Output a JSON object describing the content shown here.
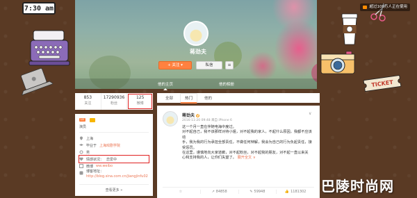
{
  "decor": {
    "clock": "7:30 am",
    "ticket": "TICKET",
    "watermark": "巴陵时尚网"
  },
  "cover": {
    "notice": "超过100万人正在使用",
    "username": "蒋劲夫",
    "subtitle": "",
    "follow_label": "+ 关注 ▾",
    "message_label": "私信",
    "more_label": "≡",
    "tabs": [
      {
        "label": "他的主页",
        "active": true
      },
      {
        "label": "他的相册",
        "active": false
      }
    ]
  },
  "stats": [
    {
      "num": "853",
      "label": "关注"
    },
    {
      "num": "17290936",
      "label": "粉丝"
    },
    {
      "num": "125",
      "label": "微博",
      "highlight": true
    }
  ],
  "info": {
    "level_label": "LV",
    "level_text": "",
    "tag": "演员",
    "location": "上海",
    "school_prefix": "毕业于",
    "school": "上海戏剧学院",
    "gender_label": "男",
    "feeling_prefix": "情感状况：",
    "feeling": "恋爱中",
    "weibo_prefix": "微博",
    "weibo": "ww.weibo",
    "blog_prefix": "博客地址：",
    "blog": "http://blog.sina.com.cn/jiangjinfu02",
    "more_label": "查看更多 »"
  },
  "feed_tabs": [
    {
      "label": "全部",
      "active": false
    },
    {
      "label": "热门",
      "active": true
    },
    {
      "label": "他的",
      "active": false
    }
  ],
  "post": {
    "author": "蒋劲夫",
    "verified": "V",
    "time": "2016-11-20 09:48 来自 iPhone 6",
    "lines": [
      "这一个月一直在伴随电海中度过。",
      "对不起自己，我不该那样对待小姐，对不起我的家人，不起什么原因，我都不应该动",
      "手，我为我的行为承担全部责任，不做任何辩解，我会为自己的行为负起责任，接",
      "受惩罚。",
      "在这里，谨慎地向大家道歉，对不起粉丝，对不起我的朋友，对不起一直以来关",
      "心和支持我的人，让你们失望了。"
    ],
    "more_link": "展开全文 ∨",
    "actions": [
      {
        "label": "☆",
        "count": ""
      },
      {
        "label": "↗",
        "count": "84858"
      },
      {
        "label": "✎",
        "count": "59948"
      },
      {
        "label": "👍",
        "count": "1181302"
      }
    ]
  }
}
